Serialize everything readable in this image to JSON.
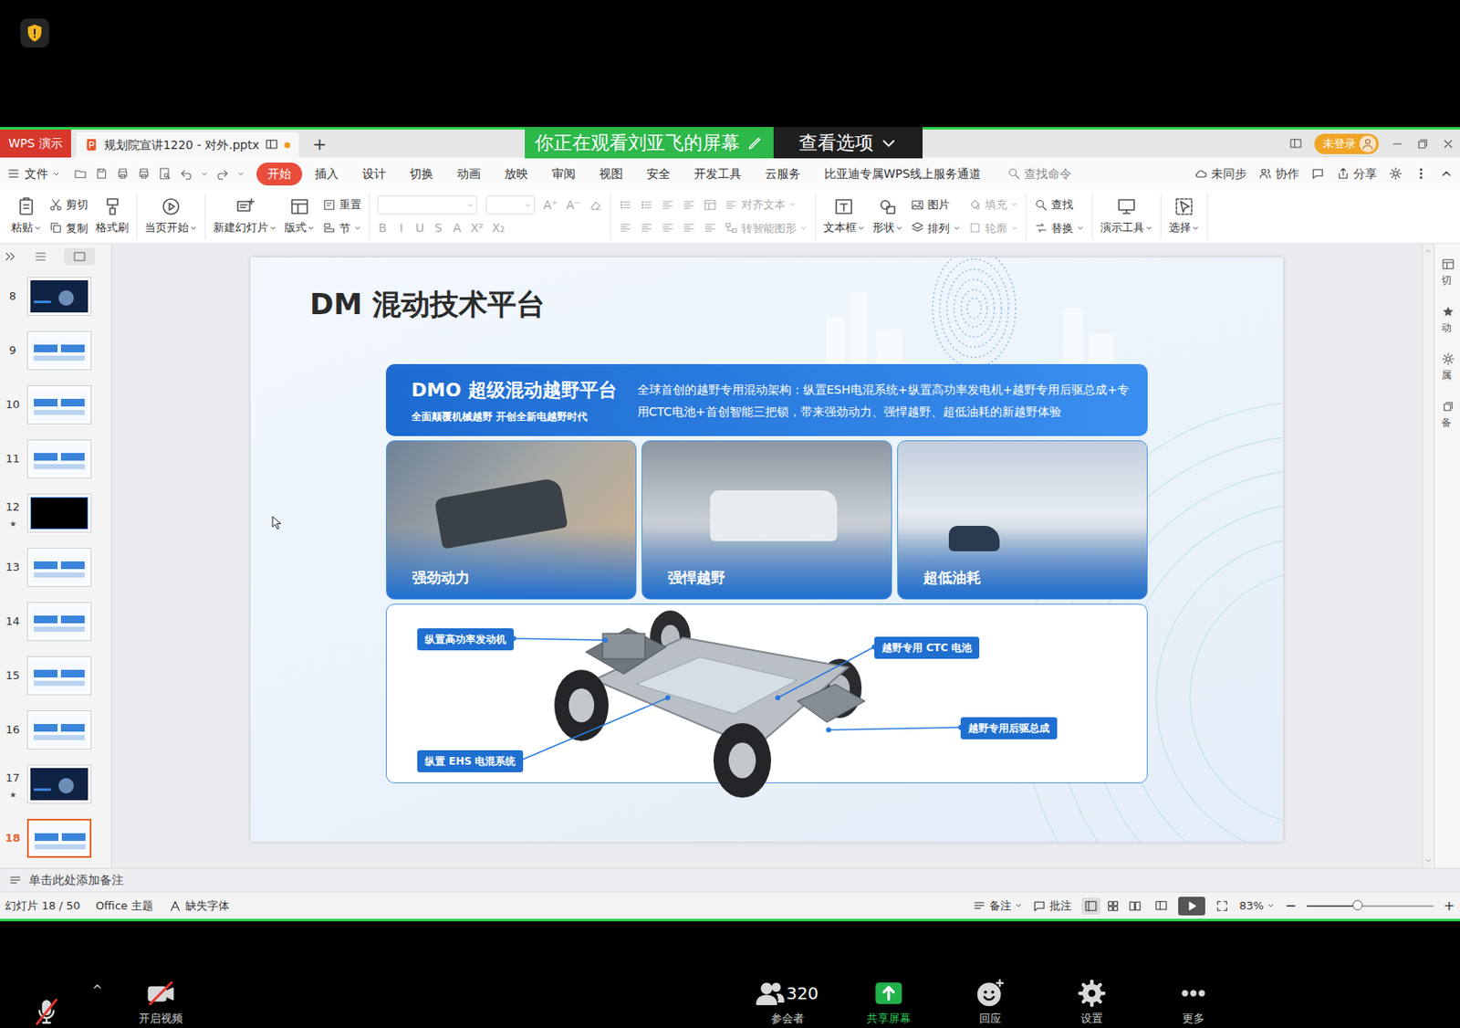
{
  "top": {
    "share_banner": "你正在观看刘亚飞的屏幕",
    "view_options": "查看选项"
  },
  "app": {
    "logo": "WPS 演示",
    "file_tab": "规划院宣讲1220 - 对外.pptx",
    "file_unsaved": true,
    "new_tab": "+",
    "login": "未登录"
  },
  "menu": {
    "file": "文件",
    "tabs": [
      {
        "label": "开始",
        "selected": true
      },
      {
        "label": "插入",
        "selected": false
      },
      {
        "label": "设计",
        "selected": false
      },
      {
        "label": "切换",
        "selected": false
      },
      {
        "label": "动画",
        "selected": false
      },
      {
        "label": "放映",
        "selected": false
      },
      {
        "label": "审阅",
        "selected": false
      },
      {
        "label": "视图",
        "selected": false
      },
      {
        "label": "安全",
        "selected": false
      },
      {
        "label": "开发工具",
        "selected": false
      },
      {
        "label": "云服务",
        "selected": false
      },
      {
        "label": "比亚迪专属WPS线上服务通道",
        "selected": false
      }
    ],
    "search_placeholder": "查找命令",
    "right": [
      "未同步",
      "协作",
      "分享"
    ]
  },
  "ribbon": {
    "groups": [
      {
        "kind": "buttons",
        "items": [
          {
            "label": "粘贴",
            "kind": "big",
            "disabled": false,
            "dropdown": true
          },
          {
            "label": "剪切",
            "kind": "small",
            "disabled": false,
            "dropdown": false
          },
          {
            "label": "复制",
            "kind": "small",
            "disabled": false,
            "dropdown": false
          },
          {
            "label": "格式刷",
            "kind": "big",
            "disabled": false,
            "dropdown": false
          }
        ]
      },
      {
        "kind": "buttons",
        "items": [
          {
            "label": "当页开始",
            "kind": "big",
            "disabled": false,
            "dropdown": true
          }
        ]
      },
      {
        "kind": "buttons",
        "items": [
          {
            "label": "新建幻灯片",
            "kind": "big",
            "disabled": false,
            "dropdown": true
          },
          {
            "label": "版式",
            "kind": "big",
            "disabled": false,
            "dropdown": true
          },
          {
            "label": "重置",
            "kind": "small",
            "disabled": false,
            "dropdown": false
          },
          {
            "label": "节",
            "kind": "small",
            "disabled": false,
            "dropdown": true
          }
        ]
      },
      {
        "kind": "font",
        "disabled": true,
        "size_glyphs": [
          "A⁺",
          "A⁻"
        ],
        "glyphs": [
          "B",
          "I",
          "U",
          "S",
          "A",
          "X²",
          "X₂"
        ]
      },
      {
        "kind": "paragraph",
        "items": [
          {
            "label": "对齐文本",
            "kind": "small",
            "disabled": true,
            "dropdown": true
          },
          {
            "label": "转智能图形",
            "kind": "small",
            "disabled": true,
            "dropdown": true
          }
        ]
      },
      {
        "kind": "buttons",
        "items": [
          {
            "label": "文本框",
            "kind": "big",
            "disabled": false,
            "dropdown": true
          },
          {
            "label": "形状",
            "kind": "big",
            "disabled": false,
            "dropdown": true
          },
          {
            "label": "图片",
            "kind": "small",
            "disabled": false,
            "dropdown": false
          },
          {
            "label": "排列",
            "kind": "small",
            "disabled": false,
            "dropdown": true
          },
          {
            "label": "填充",
            "kind": "small",
            "disabled": true,
            "dropdown": true
          },
          {
            "label": "轮廓",
            "kind": "small",
            "disabled": true,
            "dropdown": true
          }
        ]
      },
      {
        "kind": "buttons",
        "items": [
          {
            "label": "查找",
            "kind": "small",
            "disabled": false,
            "dropdown": false
          },
          {
            "label": "替换",
            "kind": "small",
            "disabled": false,
            "dropdown": true
          }
        ]
      },
      {
        "kind": "buttons",
        "items": [
          {
            "label": "演示工具",
            "kind": "big",
            "disabled": false,
            "dropdown": true
          }
        ]
      },
      {
        "kind": "buttons",
        "items": [
          {
            "label": "选择",
            "kind": "big",
            "disabled": false,
            "dropdown": true
          }
        ]
      }
    ]
  },
  "thumbnails": [
    {
      "number": "8",
      "selected": false,
      "animated": false,
      "kind": "dark"
    },
    {
      "number": "9",
      "selected": false,
      "animated": false,
      "kind": "light"
    },
    {
      "number": "10",
      "selected": false,
      "animated": false,
      "kind": "light"
    },
    {
      "number": "11",
      "selected": false,
      "animated": false,
      "kind": "light"
    },
    {
      "number": "12",
      "selected": false,
      "animated": true,
      "kind": "black"
    },
    {
      "number": "13",
      "selected": false,
      "animated": false,
      "kind": "light"
    },
    {
      "number": "14",
      "selected": false,
      "animated": false,
      "kind": "light"
    },
    {
      "number": "15",
      "selected": false,
      "animated": false,
      "kind": "light"
    },
    {
      "number": "16",
      "selected": false,
      "animated": false,
      "kind": "light"
    },
    {
      "number": "17",
      "selected": false,
      "animated": true,
      "kind": "dark"
    },
    {
      "number": "18",
      "selected": true,
      "animated": false,
      "kind": "light"
    }
  ],
  "slide": {
    "title": "DM 混动技术平台",
    "banner": {
      "title": "DMO 超级混动越野平台",
      "subtitle": "全面颠覆机械越野 开创全新电越野时代",
      "description": "全球首创的越野专用混动架构：纵置ESH电混系统+纵置高功率发电机+越野专用后驱总成+专用CTC电池+首创智能三把锁，带来强劲动力、强悍越野、超低油耗的新越野体验"
    },
    "features": [
      {
        "label": "强劲动力"
      },
      {
        "label": "强悍越野"
      },
      {
        "label": "超低油耗"
      }
    ],
    "callouts": [
      {
        "label": "纵置高功率发动机"
      },
      {
        "label": "越野专用 CTC 电池"
      },
      {
        "label": "越野专用后驱总成"
      },
      {
        "label": "纵置 EHS 电混系统"
      }
    ]
  },
  "right_panel": [
    "切",
    "动",
    "属",
    "备"
  ],
  "notes": "单击此处添加备注",
  "status_bar": {
    "slide": "幻灯片 18 / 50",
    "theme": "Office 主题",
    "missing_font": "缺失字体",
    "notes": "备注",
    "comments": "批注",
    "views": [
      {
        "selected": true
      },
      {
        "selected": false
      },
      {
        "selected": false
      }
    ],
    "zoom": "83%",
    "zoom_out": "−",
    "zoom_in": "+",
    "zoom_level": 0.4
  },
  "meeting": {
    "mic_muted": true,
    "video_muted": true,
    "video_label": "开启视频",
    "participants_count": "320",
    "participants_label": "参会者",
    "share_label": "共享屏幕",
    "reaction_label": "回应",
    "settings_label": "设置",
    "more_label": "更多"
  }
}
